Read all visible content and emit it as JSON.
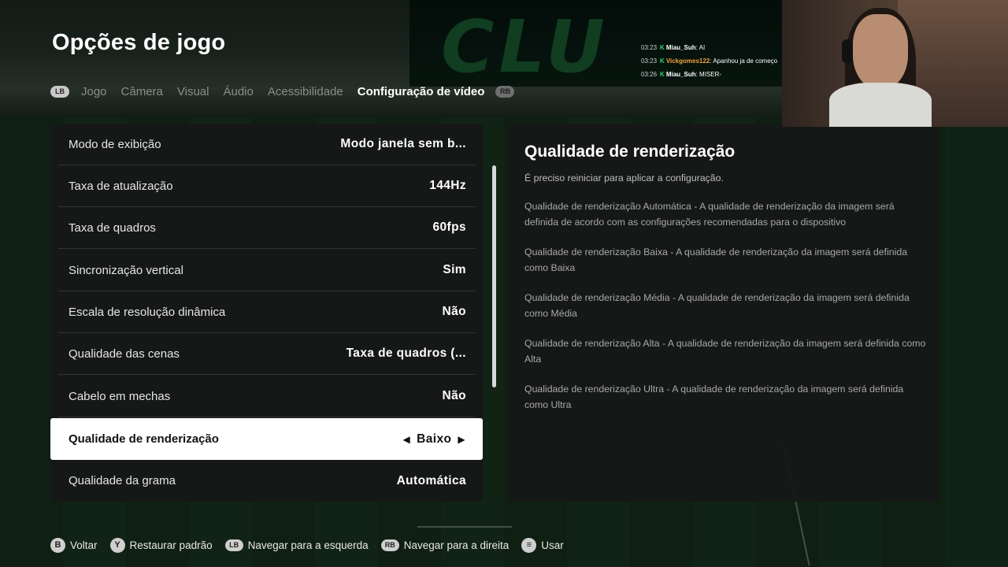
{
  "page": {
    "title": "Opções de jogo"
  },
  "tabs": {
    "left_bumper": "LB",
    "right_bumper": "RB",
    "items": [
      {
        "label": "Jogo",
        "active": false
      },
      {
        "label": "Câmera",
        "active": false
      },
      {
        "label": "Visual",
        "active": false
      },
      {
        "label": "Áudio",
        "active": false
      },
      {
        "label": "Acessibilidade",
        "active": false
      },
      {
        "label": "Configuração de vídeo",
        "active": true
      }
    ]
  },
  "settings": [
    {
      "label": "Modo de exibição",
      "value": "Modo janela sem b..."
    },
    {
      "label": "Taxa de atualização",
      "value": "144Hz"
    },
    {
      "label": "Taxa de quadros",
      "value": "60fps"
    },
    {
      "label": "Sincronização vertical",
      "value": "Sim"
    },
    {
      "label": "Escala de resolução dinâmica",
      "value": "Não"
    },
    {
      "label": "Qualidade das cenas",
      "value": "Taxa de quadros (..."
    },
    {
      "label": "Cabelo em mechas",
      "value": "Não"
    },
    {
      "label": "Qualidade de renderização",
      "value": "Baixo",
      "selected": true
    },
    {
      "label": "Qualidade da grama",
      "value": "Automática"
    }
  ],
  "info": {
    "title": "Qualidade de renderização",
    "note": "É preciso reiniciar para aplicar a configuração.",
    "descriptions": [
      "Qualidade de renderização Automática - A qualidade de renderização da imagem será definida de acordo com as configurações recomendadas para o dispositivo",
      "Qualidade de renderização Baixa - A qualidade de renderização da imagem será definida como Baixa",
      "Qualidade de renderização Média - A qualidade de renderização da imagem será definida como Média",
      "Qualidade de renderização Alta - A qualidade de renderização da imagem será definida como Alta",
      "Qualidade de renderização Ultra - A qualidade de renderização da imagem será definida como Ultra"
    ]
  },
  "chat": [
    {
      "time": "03:23",
      "user": "Miau_Suh",
      "user_color": "#ffffff",
      "message": "AI"
    },
    {
      "time": "03:23",
      "user": "Vickgomes122",
      "user_color": "#f0a23a",
      "message": "Apanhou ja de começo"
    },
    {
      "time": "03:26",
      "user": "Miau_Suh",
      "user_color": "#ffffff",
      "message": "MISER-"
    }
  ],
  "footer": [
    {
      "button": "B",
      "icon": "b-button-icon",
      "label": "Voltar"
    },
    {
      "button": "Y",
      "icon": "y-button-icon",
      "label": "Restaurar padrão"
    },
    {
      "button": "LB",
      "icon": "lb-button-icon",
      "label": "Navegar para a esquerda"
    },
    {
      "button": "RB",
      "icon": "rb-button-icon",
      "label": "Navegar para a direita"
    },
    {
      "button": "≡",
      "icon": "menu-button-icon",
      "label": "Usar"
    }
  ],
  "background": {
    "banner_text": "CLU"
  },
  "colors": {
    "panel_bg": "#161817",
    "selected_row_bg": "#ffffff",
    "accent_green": "#27d36b"
  }
}
